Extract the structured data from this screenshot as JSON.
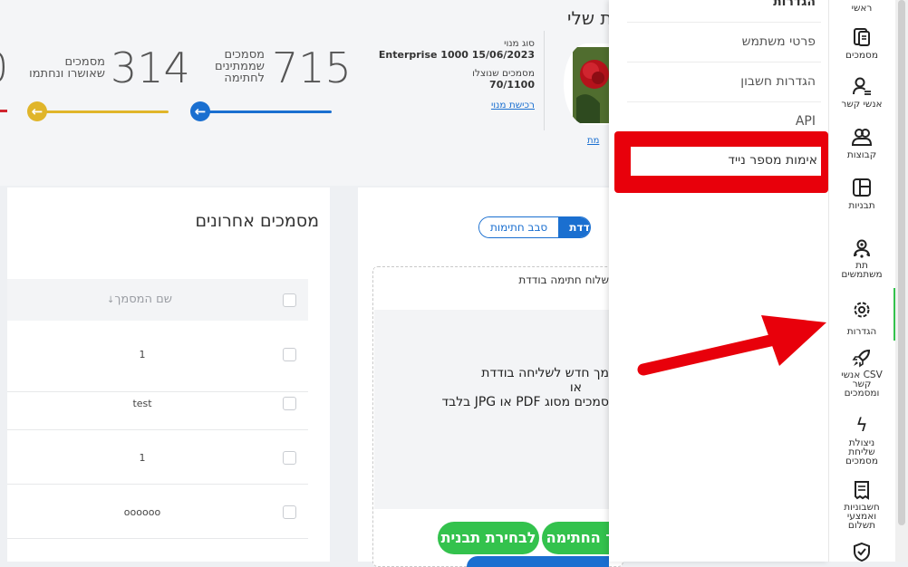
{
  "profile": {
    "title_fragment": "ת שלי",
    "photo_link": "מת",
    "plan_label": "סוג מנוי",
    "plan_value": "Enterprise 1000 15/06/2023",
    "sent_label": "מסמכים שנוצלו",
    "sent_value": "70/1100",
    "buy_link": "רכישת מנוי"
  },
  "stats": [
    {
      "number": "715",
      "label_lines": [
        "מסמכים",
        "שממתינים",
        "לחתימה"
      ],
      "color": "#1a6fd0",
      "progress": 1.0
    },
    {
      "number": "314",
      "label_lines": [
        "מסמכים",
        "שאושרו ונחתמו"
      ],
      "color": "#e0b52a",
      "progress": 1.0
    }
  ],
  "left_panel": {
    "title": "מסמכים אחרונים",
    "column_header": "שם המסמך",
    "sort_icon": "↓",
    "rows": [
      {
        "name": "1"
      },
      {
        "name": "test"
      },
      {
        "name": "1"
      },
      {
        "name": "oooooo"
      }
    ]
  },
  "center_panel": {
    "tab_active": "דדת",
    "tab_inactive": "סבב חתימות",
    "box_title": "שלוח חתימה בודדת",
    "drop_line1": "מך חדש לשליחה בודדת",
    "drop_line2": "או",
    "drop_line3": "סמכים מסוג PDF או JPG בלבד",
    "btn_template": "לבחירת תבנית",
    "btn_signature": "ר החתימה"
  },
  "dropdown": {
    "header": "הגדרות",
    "items": [
      "פרטי משתמש",
      "הגדרות חשבון",
      "API",
      "אימות מספר נייד"
    ],
    "highlight_color": "#e8000b"
  },
  "sidebar": {
    "items": [
      {
        "label": "ראשי",
        "icon": "home-icon"
      },
      {
        "label": "מסמכים",
        "icon": "documents-icon"
      },
      {
        "label": "אנשי קשר",
        "icon": "contacts-icon"
      },
      {
        "label": "קבוצות",
        "icon": "groups-icon"
      },
      {
        "label": "תבניות",
        "icon": "templates-icon"
      },
      {
        "label": "תת משתמשים",
        "icon": "sub-users-icon"
      },
      {
        "label": "הגדרות",
        "icon": "settings-icon"
      },
      {
        "label": "CSV אנשי קשר ומסמכים",
        "icon": "csv-rocket-icon"
      },
      {
        "label": "ניצולת שליחת מסמכים",
        "icon": "usage-bolt-icon"
      },
      {
        "label": "חשבוניות ואמצעי תשלום",
        "icon": "invoices-icon"
      },
      {
        "label": "",
        "icon": "shield-check-icon"
      }
    ],
    "active_item": "הגדרות",
    "accent": "#33c24d"
  },
  "annotation": {
    "arrow_color": "#e8000b"
  }
}
